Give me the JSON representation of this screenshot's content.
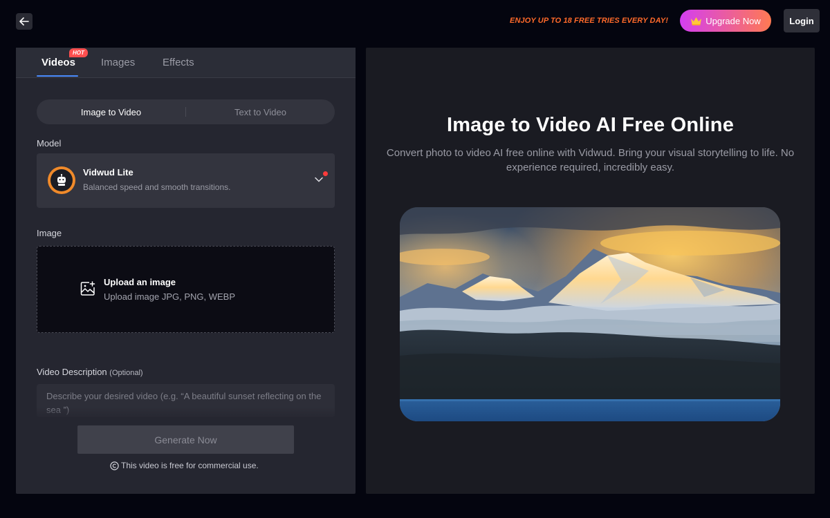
{
  "header": {
    "back_icon": "arrow-left-icon",
    "promo_text": "ENJOY UP TO 18 FREE TRIES EVERY DAY!",
    "upgrade_label": "Upgrade Now",
    "upgrade_icon": "crown-icon",
    "login_label": "Login"
  },
  "tabs": [
    {
      "label": "Videos",
      "active": true,
      "badge": "HOT"
    },
    {
      "label": "Images",
      "active": false
    },
    {
      "label": "Effects",
      "active": false
    }
  ],
  "mode_toggle": {
    "options": [
      "Image to Video",
      "Text to Video"
    ],
    "selected": "Image to Video"
  },
  "model": {
    "section_label": "Model",
    "name": "Vidwud Lite",
    "description": "Balanced speed and smooth transitions.",
    "icon": "robot-avatar-icon"
  },
  "image_upload": {
    "section_label": "Image",
    "title": "Upload an image",
    "subtitle": "Upload image JPG, PNG, WEBP",
    "icon": "image-upload-icon"
  },
  "video_description": {
    "label": "Video Description",
    "optional_label": "(Optional)",
    "placeholder": "Describe your desired video (e.g. “A beautiful sunset reflecting on the sea ”)",
    "value": ""
  },
  "generate": {
    "label": "Generate Now",
    "license_note": "This video is free for commercial use.",
    "license_icon": "copyright-icon"
  },
  "hero": {
    "title": "Image to Video AI Free Online",
    "subtitle": "Convert photo to video AI free online with Vidwud. Bring your visual storytelling to life. No experience required, incredibly easy."
  },
  "colors": {
    "background": "#04050f",
    "panel": "#252630",
    "accent_tab": "#4a8cff",
    "promo": "#ff6a2a",
    "upgrade_gradient_start": "#d43ef1",
    "upgrade_gradient_end": "#ff7a52",
    "hot_badge": "#ff4f4f"
  }
}
